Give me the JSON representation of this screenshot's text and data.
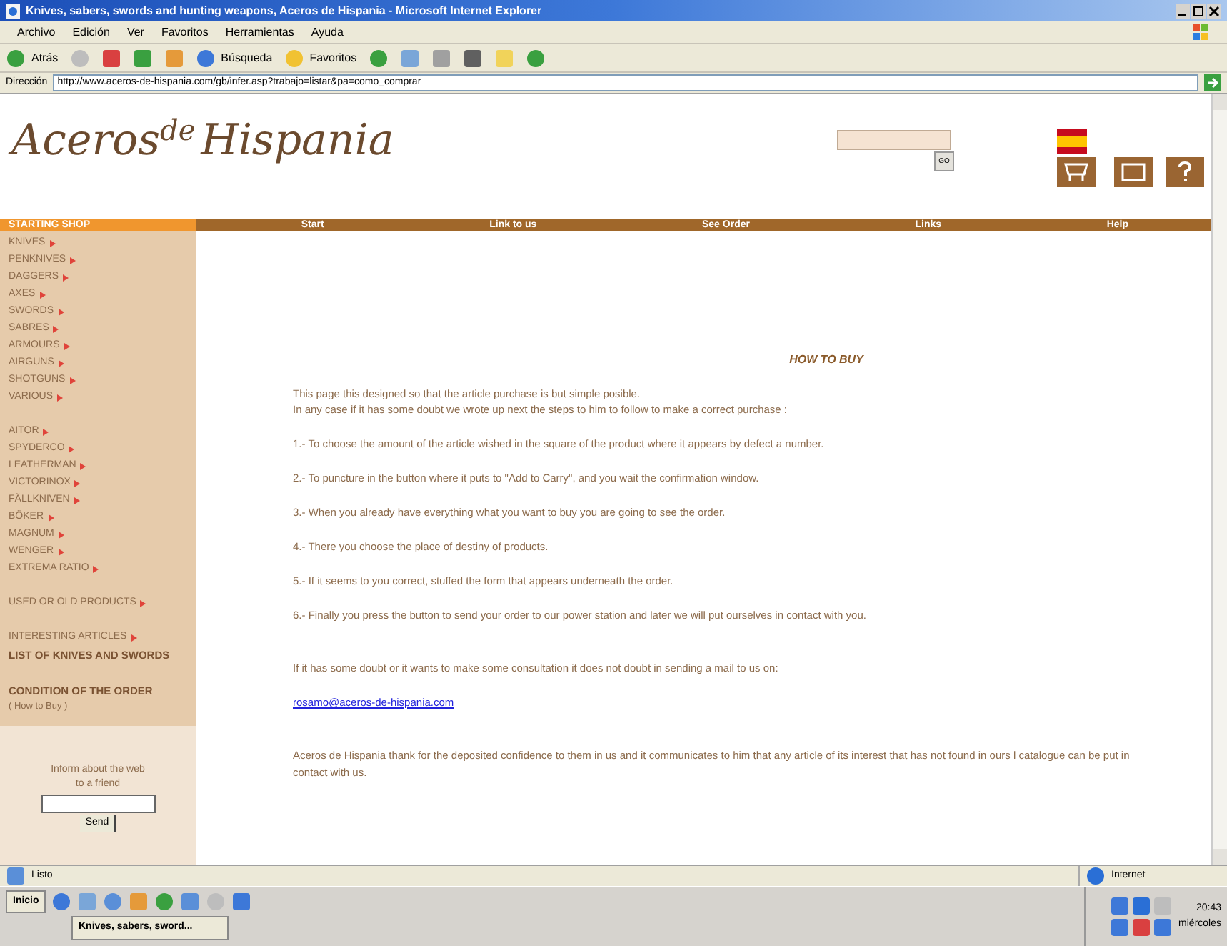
{
  "window": {
    "title": "Knives, sabers, swords and hunting weapons, Aceros de Hispania - Microsoft Internet Explorer"
  },
  "menu": [
    "Archivo",
    "Edición",
    "Ver",
    "Favoritos",
    "Herramientas",
    "Ayuda"
  ],
  "toolbar": {
    "back": "Atrás",
    "search": "Búsqueda",
    "favorites": "Favoritos"
  },
  "address": {
    "label": "Dirección",
    "value": "http://www.aceros-de-hispania.com/gb/infer.asp?trabajo=listar&pa=como_comprar"
  },
  "page": {
    "logo": {
      "main": "Aceros",
      "super": "de",
      "second": "Hispania"
    },
    "search": {
      "button": "GO"
    },
    "nav": {
      "title": "STARTING SHOP",
      "items": [
        "Start",
        "Link to us",
        "See Order",
        "Links",
        "Help"
      ]
    },
    "sidebar": {
      "groups": [
        {
          "items": [
            {
              "label": "KNIVES",
              "kind": "link"
            },
            {
              "label": "PENKNIVES",
              "kind": "link"
            },
            {
              "label": "DAGGERS",
              "kind": "link"
            },
            {
              "label": "AXES",
              "kind": "link"
            },
            {
              "label": "SWORDS",
              "kind": "link"
            },
            {
              "label": "SABRES",
              "kind": "link"
            },
            {
              "label": "ARMOURS",
              "kind": "link"
            },
            {
              "label": "AIRGUNS",
              "kind": "link"
            },
            {
              "label": "SHOTGUNS",
              "kind": "link"
            },
            {
              "label": "VARIOUS",
              "kind": "link"
            }
          ]
        },
        {
          "items": [
            {
              "label": "AITOR",
              "kind": "link"
            },
            {
              "label": "SPYDERCO",
              "kind": "link"
            },
            {
              "label": "LEATHERMAN",
              "kind": "link"
            },
            {
              "label": "VICTORINOX",
              "kind": "link"
            },
            {
              "label": "FÄLLKNIVEN",
              "kind": "link"
            },
            {
              "label": "BÖKER",
              "kind": "link"
            },
            {
              "label": "MAGNUM",
              "kind": "link"
            },
            {
              "label": "WENGER",
              "kind": "link"
            },
            {
              "label": "EXTREMA RATIO",
              "kind": "link"
            }
          ]
        },
        {
          "items": [
            {
              "label": "USED OR OLD PRODUCTS",
              "kind": "link"
            }
          ]
        },
        {
          "items": [
            {
              "label": "INTERESTING ARTICLES",
              "kind": "link"
            },
            {
              "label": "LIST OF KNIVES AND SWORDS",
              "kind": "heading"
            }
          ]
        },
        {
          "items": [
            {
              "label": "CONDITION OF THE ORDER",
              "kind": "heading"
            },
            {
              "label": "( How to Buy )",
              "kind": "sublink"
            }
          ]
        }
      ],
      "friend": {
        "label": "Inform about the web to a friend",
        "button": "Send"
      }
    },
    "content": {
      "title": "HOW TO BUY",
      "intro": [
        "This page this designed so that the article purchase is but simple posible.",
        "In any case if it has some doubt we wrote up next the steps to him to follow to make a correct purchase :"
      ],
      "steps": [
        "1.- To choose the amount of the article wished in the square of the product where it appears by defect a number.",
        "2.- To puncture in the button where it puts to \"Add to Carry\", and you wait the confirmation window.",
        "3.- When you already have everything what you want to buy you are going to see the order.",
        "4.- There you choose the place of destiny of products.",
        "5.- If it seems to you correct, stuffed the form that appears underneath the order.",
        "6.- Finally you press the button to send your order to our power station and later we will put ourselves in contact with you."
      ],
      "contact": "If it has some doubt or it wants to make some consultation it does not doubt in sending a mail to us on:",
      "email": "rosamo@aceros-de-hispania.com",
      "thanks": "Aceros de Hispania thank for the deposited confidence to them in us and it communicates to him that any article of its interest that has not found in ours l catalogue can be put in contact with us."
    }
  },
  "status_bar": {
    "text": "Listo",
    "zone": "Internet"
  },
  "taskbar": {
    "start": "Inicio",
    "task": "Knives, sabers, sword...",
    "time": "20:43",
    "day": "miércoles"
  }
}
